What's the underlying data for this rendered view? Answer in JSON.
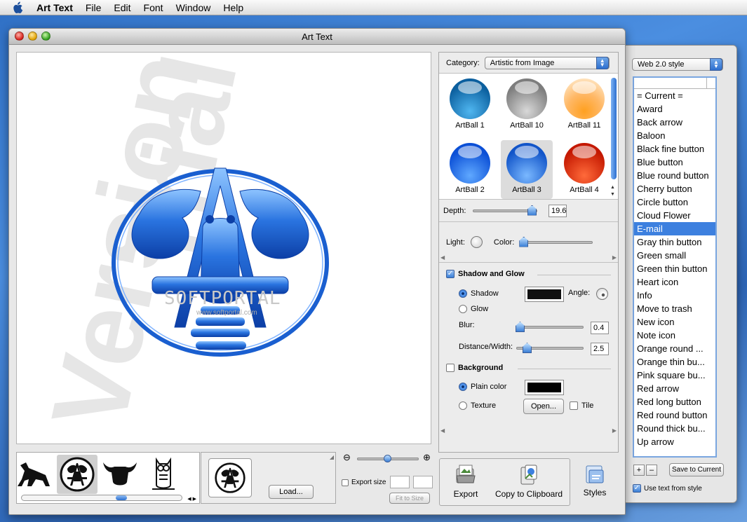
{
  "menubar": {
    "app_name": "Art Text",
    "items": [
      "File",
      "Edit",
      "Font",
      "Window",
      "Help"
    ]
  },
  "window": {
    "title": "Art Text"
  },
  "canvas": {
    "watermark_line1": "Trial",
    "watermark_line2": "Version",
    "overlay_brand": "SOFTPORTAL",
    "overlay_url": "www.softportal.com"
  },
  "panel": {
    "category_label": "Category:",
    "category_value": "Artistic from Image",
    "balls": [
      {
        "label": "ArtBall 1",
        "style": "b-blue-dark"
      },
      {
        "label": "ArtBall 10",
        "style": "b-gray"
      },
      {
        "label": "ArtBall 11",
        "style": "b-orange"
      },
      {
        "label": "ArtBall 2",
        "style": "b-blue"
      },
      {
        "label": "ArtBall 3",
        "style": "b-blue3",
        "selected": true
      },
      {
        "label": "ArtBall 4",
        "style": "b-red"
      }
    ],
    "depth_label": "Depth:",
    "depth_value": "19.6",
    "light_label": "Light:",
    "color_label": "Color:",
    "shadow_glow": {
      "label": "Shadow and Glow",
      "checked": true,
      "shadow_label": "Shadow",
      "glow_label": "Glow",
      "angle_label": "Angle:",
      "blur_label": "Blur:",
      "blur_value": "0.4",
      "distance_label": "Distance/Width:",
      "distance_value": "2.5",
      "swatch_color": "#111111"
    },
    "background": {
      "label": "Background",
      "checked": false,
      "plain_label": "Plain color",
      "texture_label": "Texture",
      "open_label": "Open...",
      "tile_label": "Tile",
      "swatch_color": "#000000"
    }
  },
  "bottom": {
    "load_label": "Load...",
    "export_size_label": "Export size",
    "fit_to_size_label": "Fit to Size",
    "export_label": "Export",
    "copy_label": "Copy to Clipboard",
    "styles_label": "Styles"
  },
  "drawer": {
    "style_select": "Web 2.0 style",
    "items": [
      "= Current =",
      "Award",
      "Back arrow",
      "Baloon",
      "Black fine button",
      "Blue button",
      "Blue round button",
      "Cherry button",
      "Circle button",
      "Cloud Flower",
      "E-mail",
      "Gray thin button",
      "Green small",
      "Green thin button",
      "Heart icon",
      "Info",
      "Move to trash",
      "New icon",
      "Note icon",
      "Orange round ...",
      "Orange thin bu...",
      "Pink square bu...",
      "Red arrow",
      "Red long button",
      "Red round button",
      "Round thick bu...",
      "Up arrow"
    ],
    "selected_index": 10,
    "add_label": "+",
    "remove_label": "–",
    "save_label": "Save to Current",
    "use_text_label": "Use text from style",
    "use_text_checked": true
  },
  "colors": {
    "accent": "#3d80df",
    "logo_blue": "#1a5fd0"
  }
}
